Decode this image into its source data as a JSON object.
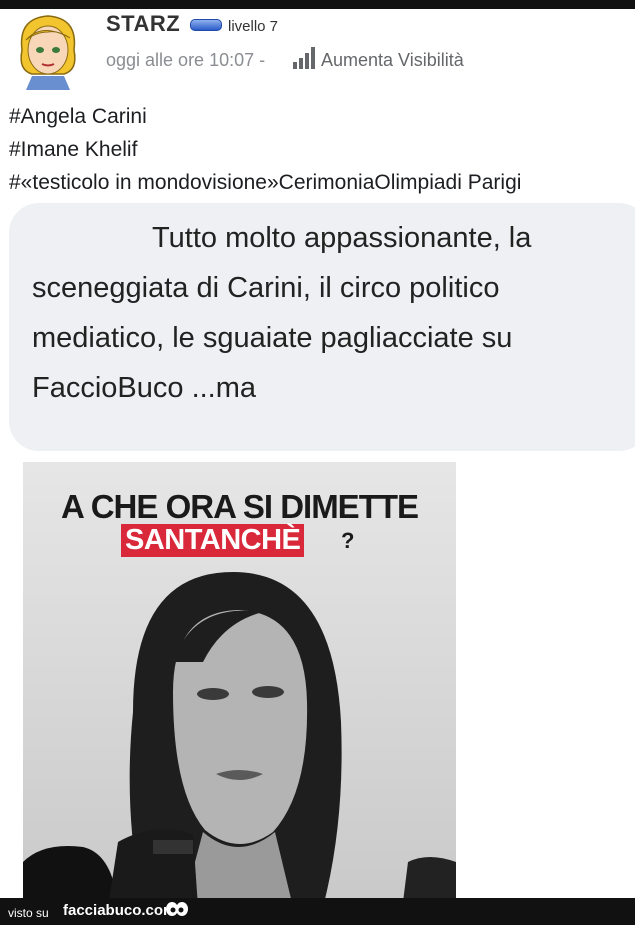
{
  "post": {
    "author": "STARZ",
    "level": "livello 7",
    "timestamp": "oggi alle ore 10:07 -",
    "boost_label": "Aumenta Visibilità",
    "hashtags": [
      "#Angela Carini",
      "#Imane Khelif",
      "#«testicolo in mondovisione»CerimoniaOlimpiadi Parigi"
    ],
    "comment": "Tutto molto appassionante, la sceneggiata di Carini, il circo politico mediatico, le sguaiate pagliacciate su FaccioBuco ...ma",
    "image": {
      "headline_line1": "A CHE ORA SI DIMETTE",
      "headline_line2": "SANTANCHÈ",
      "headline_mark": "?"
    }
  },
  "footer": {
    "visto_label": "visto su",
    "brand": "facciabuco.com"
  },
  "colors": {
    "badge": "#2b5cc9",
    "highlight": "#d8283a",
    "bubble": "#eef0f3"
  }
}
